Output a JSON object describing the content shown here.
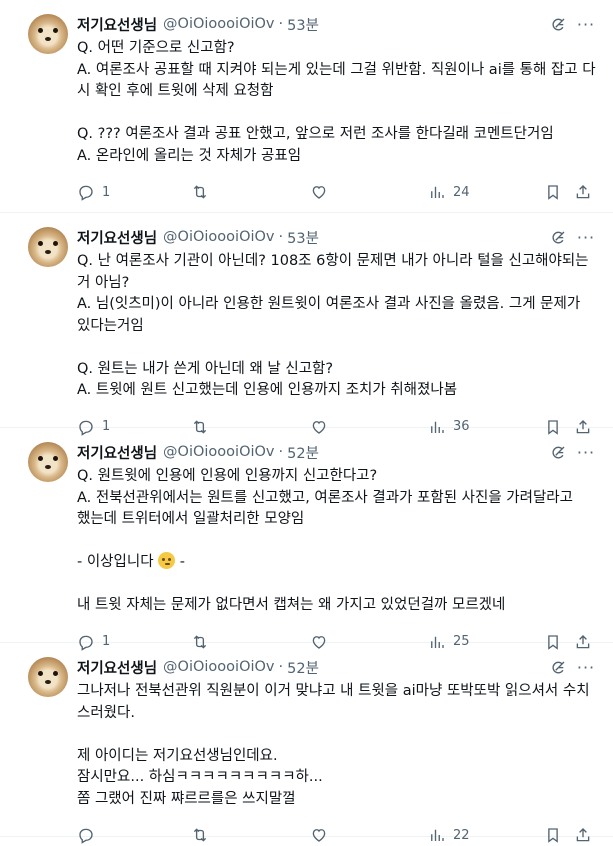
{
  "tweets": [
    {
      "name": "저기요선생님",
      "handle": "@OiOioooiOiOv",
      "dot": "·",
      "time": "53분",
      "lines": [
        "Q. 어떤 기준으로 신고함?",
        "A. 여론조사 공표할 때 지켜야 되는게 있는데 그걸 위반함. 직원이나 ai를 통해 잡고 다",
        "시 확인 후에 트윗에 삭제 요청함",
        "",
        "Q. ??? 여론조사 결과 공표 안했고, 앞으로 저런 조사를 한다길래 코멘트단거임",
        "A. 온라인에 올리는 것 자체가 공표임"
      ],
      "replies": "1",
      "views": "24"
    },
    {
      "name": "저기요선생님",
      "handle": "@OiOioooiOiOv",
      "dot": "·",
      "time": "53분",
      "lines": [
        "Q. 난 여론조사 기관이 아닌데? 108조 6항이 문제면 내가 아니라 털을 신고해야되는",
        "거 아님?",
        "A. 님(잇츠미)이 아니라 인용한 원트윗이 여론조사 결과 사진을 올렸음. 그게 문제가",
        "있다는거임",
        "",
        "Q. 원트는 내가 쓴게 아닌데 왜 날 신고함?",
        "A. 트윗에 원트 신고했는데 인용에 인용까지 조치가 취해졌나봄"
      ],
      "replies": "1",
      "views": "36"
    },
    {
      "name": "저기요선생님",
      "handle": "@OiOioooiOiOv",
      "dot": "·",
      "time": "52분",
      "lines": [
        "Q. 원트윗에 인용에 인용에 인용까지 신고한다고?",
        "A. 전북선관위에서는 원트를 신고했고, 여론조사 결과가 포함된 사진을 가려달라고",
        "했는데 트위터에서 일괄처리한 모양임",
        "",
        "- 이상입니다 ",
        "",
        "내 트윗 자체는 문제가 없다면서 캡쳐는 왜 가지고 있었던걸까 모르겠네"
      ],
      "emoji_line": 4,
      "emoji_after": "-",
      "replies": "1",
      "views": "25"
    },
    {
      "name": "저기요선생님",
      "handle": "@OiOioooiOiOv",
      "dot": "·",
      "time": "52분",
      "lines": [
        "그나저나 전북선관위 직원분이 이거 맞냐고 내 트윗을 ai마냥 또박또박 읽으셔서 수치",
        "스러웠다.",
        "",
        "제 아이디는 저기요선생님인데요.",
        "잠시만요... 하심ㅋㅋㅋㅋㅋㅋㅋㅋㅋ하...",
        "쫌 그랬어 진짜 쨔르르를은 쓰지말껄"
      ],
      "replies": "",
      "views": "22"
    }
  ],
  "icons": {
    "more": "more-options-icon",
    "grok": "grok-icon",
    "reply": "reply-icon",
    "retweet": "retweet-icon",
    "like": "like-icon",
    "views": "views-icon",
    "bookmark": "bookmark-icon",
    "share": "share-icon"
  },
  "colors": {
    "text": "#0f1419",
    "secondary": "#536471",
    "divider": "#eff3f4"
  }
}
